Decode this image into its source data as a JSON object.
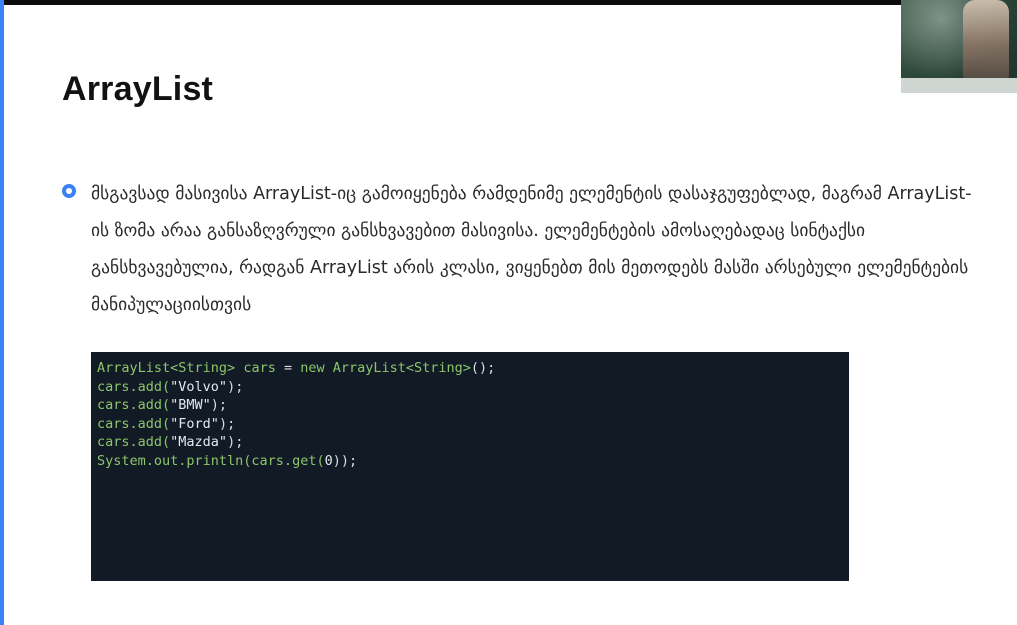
{
  "slide": {
    "title": "ArrayList",
    "bullet_text": "მსგავსად მასივისა ArrayList-იც გამოიყენება რამდენიმე ელემენტის დასაჯგუფებლად, მაგრამ ArrayList-ის ზომა არაა განსაზღვრული განსხვავებით მასივისა. ელემენტების ამოსაღებადაც სინტაქსი განსხვავებულია, რადგან ArrayList არის კლასი, ვიყენებთ მის მეთოდებს მასში არსებული ელემენტების მანიპულაციისთვის"
  },
  "code": {
    "lines": [
      {
        "parts": [
          {
            "t": "ArrayList<String>",
            "c": "type"
          },
          {
            "t": " ",
            "c": ""
          },
          {
            "t": "cars",
            "c": "var"
          },
          {
            "t": " = ",
            "c": ""
          },
          {
            "t": "new",
            "c": "kw"
          },
          {
            "t": " ",
            "c": ""
          },
          {
            "t": "ArrayList<String>",
            "c": "type"
          },
          {
            "t": "();",
            "c": ""
          }
        ]
      },
      {
        "parts": [
          {
            "t": "cars.add(",
            "c": "var"
          },
          {
            "t": "\"Volvo\"",
            "c": "str"
          },
          {
            "t": ");",
            "c": ""
          }
        ]
      },
      {
        "parts": [
          {
            "t": "cars.add(",
            "c": "var"
          },
          {
            "t": "\"BMW\"",
            "c": "str"
          },
          {
            "t": ");",
            "c": ""
          }
        ]
      },
      {
        "parts": [
          {
            "t": "cars.add(",
            "c": "var"
          },
          {
            "t": "\"Ford\"",
            "c": "str"
          },
          {
            "t": ");",
            "c": ""
          }
        ]
      },
      {
        "parts": [
          {
            "t": "cars.add(",
            "c": "var"
          },
          {
            "t": "\"Mazda\"",
            "c": "str"
          },
          {
            "t": ");",
            "c": ""
          }
        ]
      },
      {
        "parts": [
          {
            "t": "System.out.println(cars.get(",
            "c": "var"
          },
          {
            "t": "0",
            "c": "num"
          },
          {
            "t": "));",
            "c": ""
          }
        ]
      }
    ]
  },
  "colors": {
    "accent": "#3b82f6",
    "code_background": "#121a26",
    "code_identifier": "#8bc56a",
    "code_plain": "#d7dde5"
  },
  "icons": {
    "bullet": "bullet-dot-icon"
  }
}
